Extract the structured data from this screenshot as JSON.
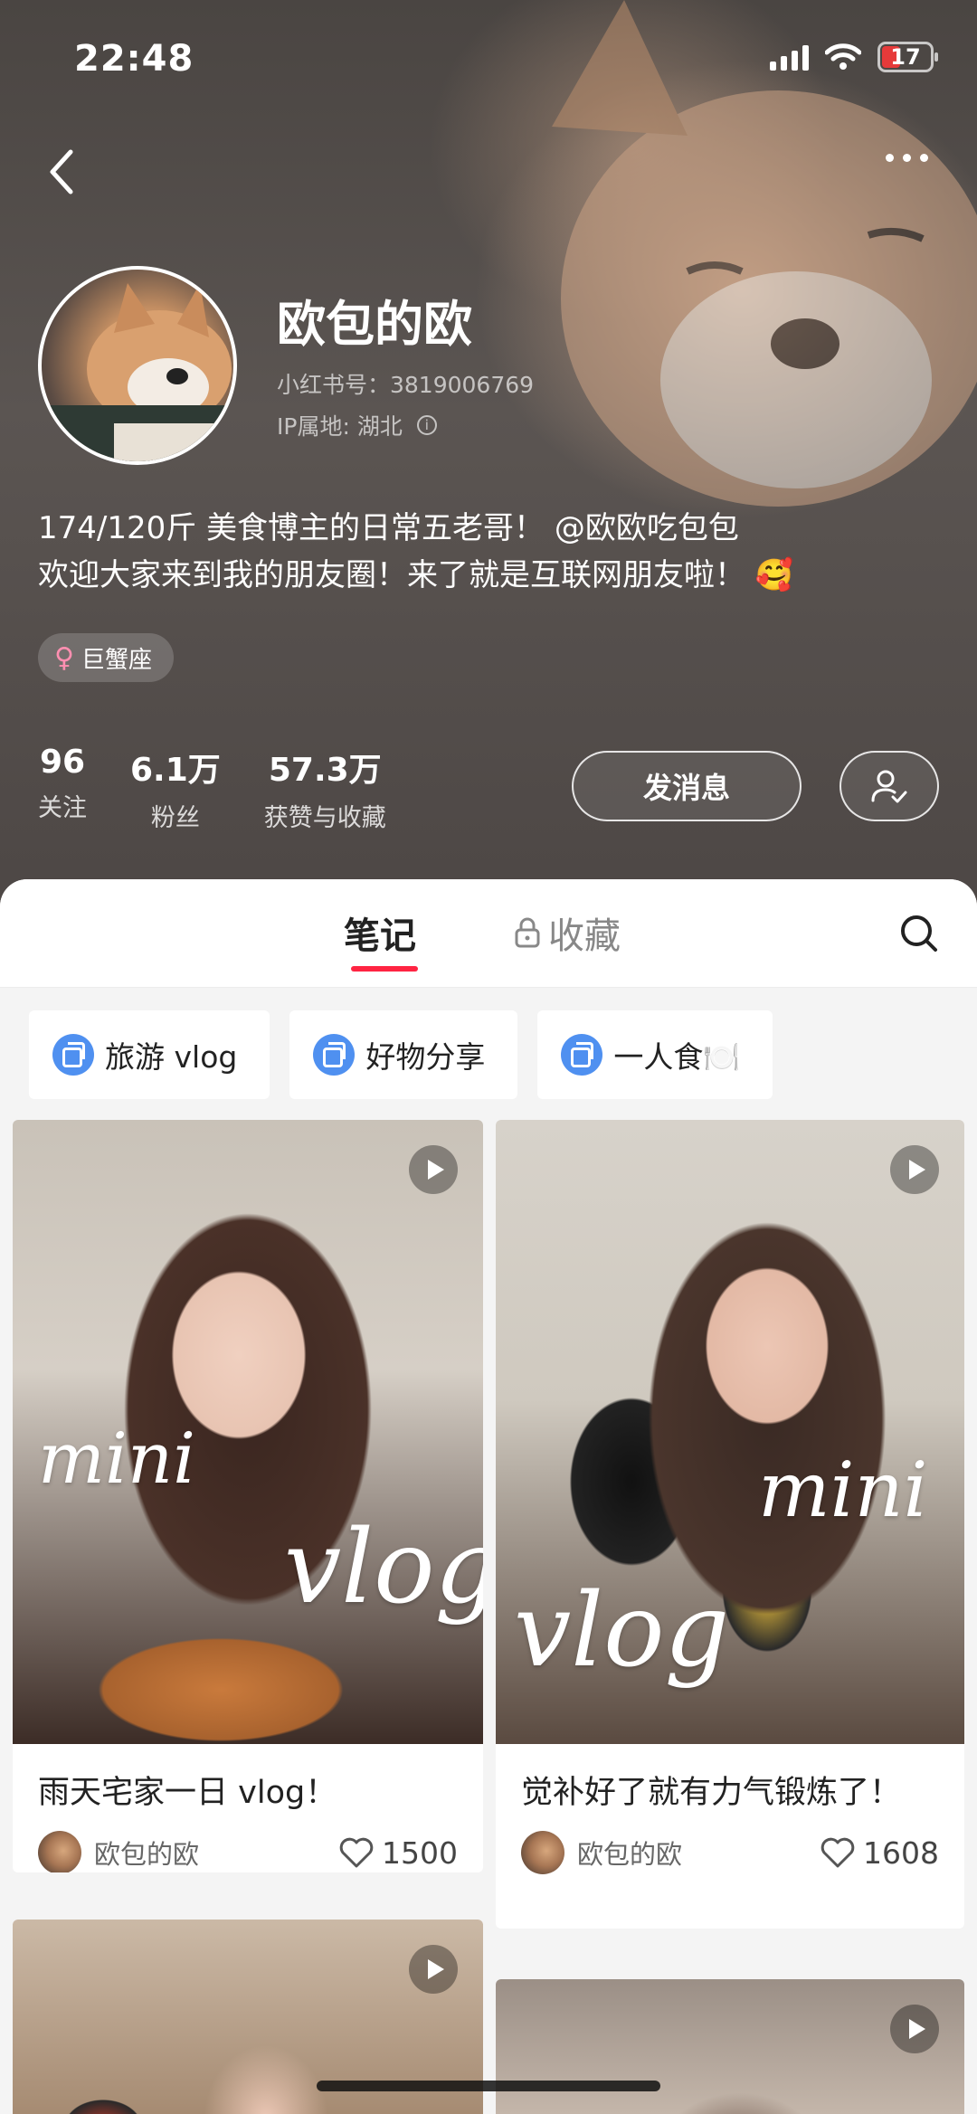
{
  "status_bar": {
    "time": "22:48",
    "battery": "17"
  },
  "profile": {
    "nickname": "欧包的欧",
    "red_id": "小红书号：3819006769",
    "ip_location": "IP属地: 湖北",
    "bio_line1_prefix": "174/120斤 美食博主的日常五老哥！",
    "bio_mention": "@欧欧吃包包",
    "bio_line2": "欢迎大家来到我的朋友圈！来了就是互联网朋友啦！",
    "bio_emoji": "🥰",
    "tag": "巨蟹座",
    "stats": [
      {
        "num": "96",
        "label": "关注"
      },
      {
        "num": "6.1万",
        "label": "粉丝"
      },
      {
        "num": "57.3万",
        "label": "获赞与收藏"
      }
    ],
    "message_button": "发消息"
  },
  "tabs": {
    "notes": "笔记",
    "collect": "收藏"
  },
  "collections": [
    {
      "label": "旅游 vlog"
    },
    {
      "label": "好物分享"
    },
    {
      "label": "一人食🍽️"
    }
  ],
  "notes": [
    {
      "title": "雨天宅家一日 vlog！",
      "author": "欧包的欧",
      "likes": "1500",
      "overlay_1": "mini",
      "overlay_2": "vlog"
    },
    {
      "title": "觉补好了就有力气锻炼了！",
      "author": "欧包的欧",
      "likes": "1608",
      "overlay_1": "mini",
      "overlay_2": "vlog"
    },
    {
      "title": "",
      "author": "",
      "likes": ""
    },
    {
      "title": "",
      "author": "",
      "likes": ""
    }
  ]
}
